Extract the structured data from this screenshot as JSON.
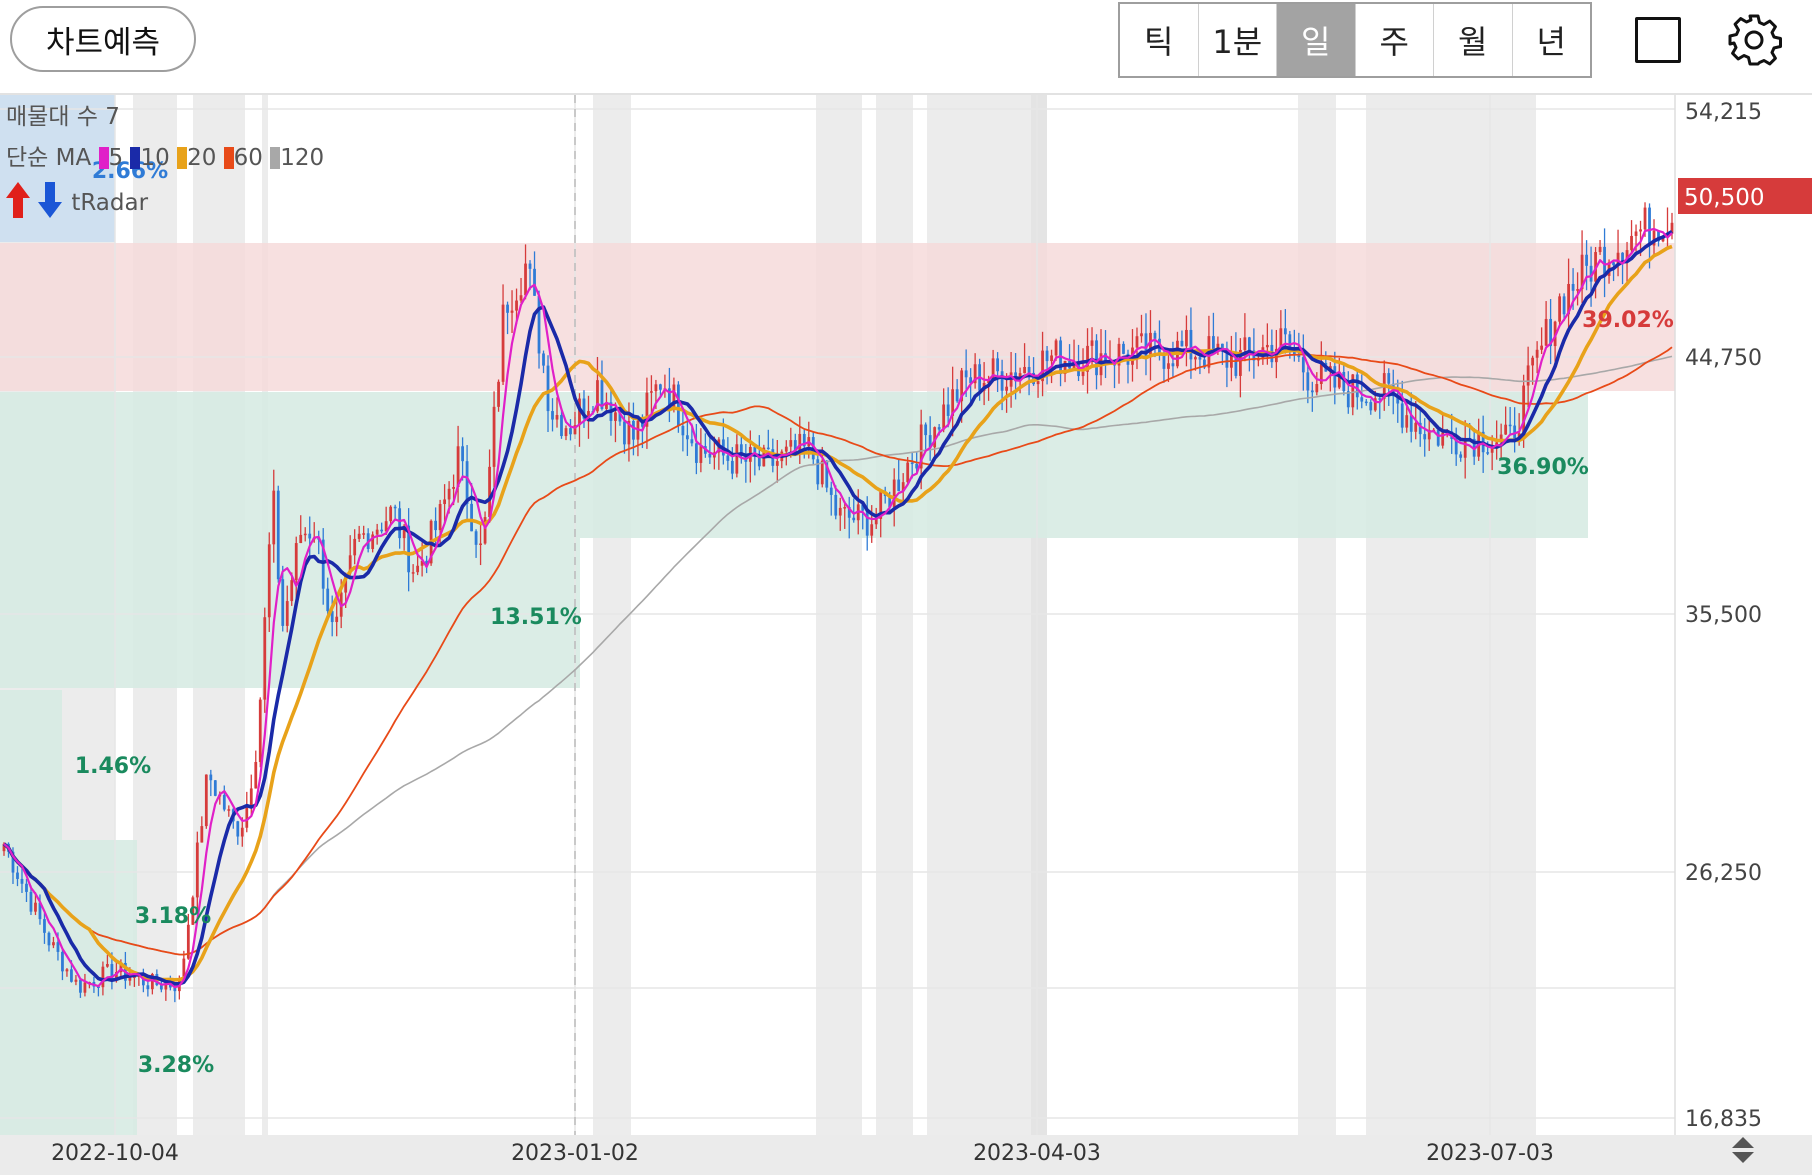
{
  "toolbar": {
    "predict_label": "차트예측",
    "periods": [
      {
        "label": "틱",
        "active": false
      },
      {
        "label": "1분",
        "active": false
      },
      {
        "label": "일",
        "active": true
      },
      {
        "label": "주",
        "active": false
      },
      {
        "label": "월",
        "active": false
      },
      {
        "label": "년",
        "active": false
      }
    ],
    "icons": [
      "fullscreen-square-icon",
      "gear-icon"
    ]
  },
  "legend": {
    "volume_profile": "매물대 수 7",
    "ma_title": "단순 MA",
    "ma_periods": [
      "5",
      "10",
      "20",
      "60",
      "120"
    ],
    "radar_label": "tRadar",
    "colors": {
      "ma5": "#e020c8",
      "ma10": "#1a2aa8",
      "ma20": "#e8a21a",
      "ma60": "#e84a18",
      "ma120": "#a8a8a8"
    }
  },
  "chart_data": {
    "type": "candlestick",
    "x_ticks": [
      "2022-10-04",
      "2023-01-02",
      "2023-04-03",
      "2023-07-03"
    ],
    "y_ticks": [
      "54,215",
      "44,750",
      "35,500",
      "26,250",
      "16,835"
    ],
    "ylim": [
      16835,
      54215
    ],
    "last_price": "50,500",
    "colors": {
      "up": "#d63b3b",
      "down": "#2f7bd6",
      "price_tag": "#d63b3b"
    },
    "percent_labels": [
      {
        "text": "2.66%",
        "color": "#2f7bd6"
      },
      {
        "text": "1.46%",
        "color": "#1a8a5e"
      },
      {
        "text": "3.18%",
        "color": "#1a8a5e"
      },
      {
        "text": "3.28%",
        "color": "#1a8a5e"
      },
      {
        "text": "13.51%",
        "color": "#1a8a5e"
      },
      {
        "text": "36.90%",
        "color": "#1a8a5e"
      },
      {
        "text": "39.02%",
        "color": "#d63b3b"
      }
    ],
    "ma_end_values": {
      "ma5": 49600,
      "ma10": 49000,
      "ma20": 47000,
      "ma60": 45100,
      "ma120": 43800
    }
  }
}
